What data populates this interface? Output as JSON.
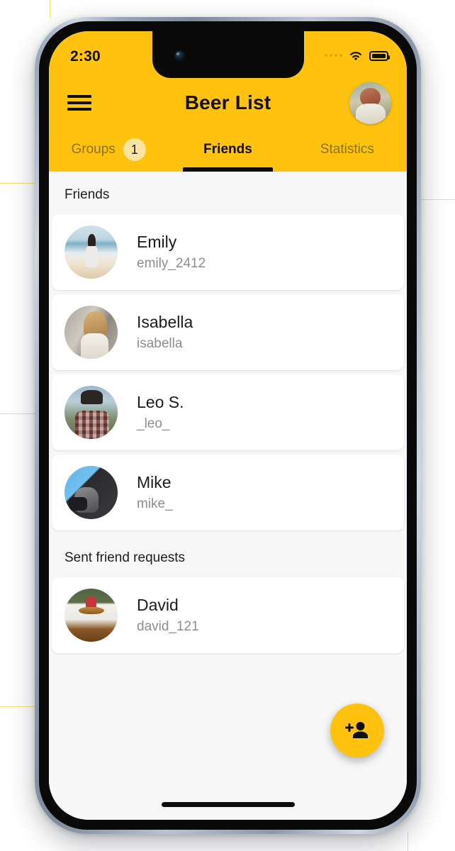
{
  "phone": {
    "status_bar": {
      "time": "2:30",
      "cellular_icon": "cellular-dots-icon",
      "wifi_icon": "wifi-icon",
      "battery_icon": "battery-full-icon"
    },
    "home_indicator": "home-indicator"
  },
  "app": {
    "title": "Beer List",
    "menu_icon": "hamburger-menu-icon",
    "profile_avatar": "user-profile-avatar",
    "accent_color": "#FFC20E",
    "badge_color": "#FBE3A2",
    "background_color": "#F7F7F7",
    "card_color": "#FFFFFF",
    "tabs": [
      {
        "label": "Groups",
        "badge": "1",
        "active": false
      },
      {
        "label": "Friends",
        "badge": null,
        "active": true
      },
      {
        "label": "Statistics",
        "badge": null,
        "active": false
      }
    ],
    "sections": [
      {
        "title": "Friends",
        "items": [
          {
            "name": "Emily",
            "username": "emily_2412",
            "avatar": "avatar-emily"
          },
          {
            "name": "Isabella",
            "username": "isabella",
            "avatar": "avatar-isabella"
          },
          {
            "name": "Leo S.",
            "username": "_leo_",
            "avatar": "avatar-leo"
          },
          {
            "name": "Mike",
            "username": "mike_",
            "avatar": "avatar-mike"
          }
        ]
      },
      {
        "title": "Sent friend requests",
        "items": [
          {
            "name": "David",
            "username": "david_121",
            "avatar": "avatar-david"
          }
        ]
      }
    ],
    "fab": {
      "icon": "person-add-icon",
      "label": "Add friend"
    }
  }
}
